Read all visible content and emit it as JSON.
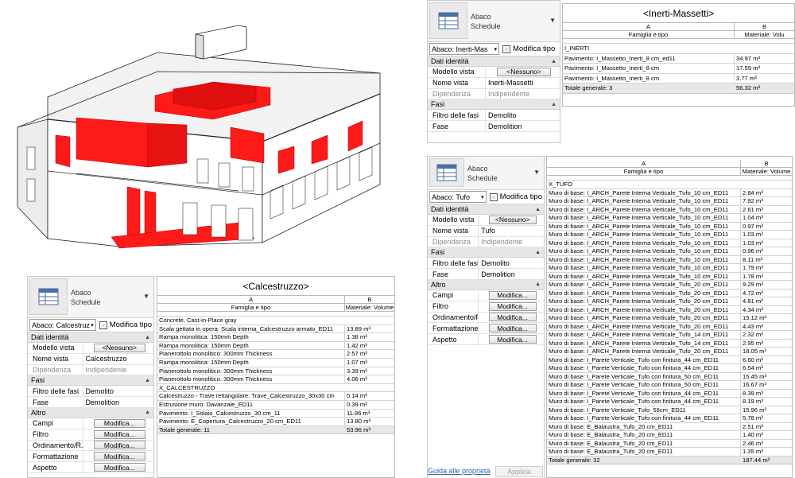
{
  "colors": {
    "highlight": "#ff1a1a",
    "link": "#2a62b8"
  },
  "model_view": {
    "icon": "building-3d-model"
  },
  "panels": {
    "calcestruzzo": {
      "type_line1": "Abaco",
      "type_line2": "Schedule",
      "selector": "Abaco: Calcestruz",
      "edit_type": "Modifica tipo",
      "sections": [
        {
          "title": "Dati identità",
          "rows": [
            {
              "k": "Modello vista",
              "v": "<Nessuno>",
              "btn": true
            },
            {
              "k": "Nome vista",
              "v": "Calcestruzzo"
            },
            {
              "k": "Dipendenza",
              "v": "Indipendente",
              "dim": true
            }
          ]
        },
        {
          "title": "Fasi",
          "rows": [
            {
              "k": "Filtro delle fasi",
              "v": "Demolito"
            },
            {
              "k": "Fase",
              "v": "Demolition"
            }
          ]
        },
        {
          "title": "Altro",
          "rows": [
            {
              "k": "Campi",
              "v": "Modifica...",
              "btn": true
            },
            {
              "k": "Filtro",
              "v": "Modifica...",
              "btn": true
            },
            {
              "k": "Ordinamento/R...",
              "v": "Modifica...",
              "btn": true
            },
            {
              "k": "Formattazione",
              "v": "Modifica...",
              "btn": true
            },
            {
              "k": "Aspetto",
              "v": "Modifica...",
              "btn": true
            }
          ]
        }
      ]
    },
    "massetti": {
      "type_line1": "Abaco",
      "type_line2": "Schedule",
      "selector": "Abaco: Inerti-Mas",
      "edit_type": "Modifica tipo",
      "sections": [
        {
          "title": "Dati identità",
          "rows": [
            {
              "k": "Modello vista",
              "v": "<Nessuno>",
              "btn": true
            },
            {
              "k": "Nome vista",
              "v": "Inerti-Massetti"
            },
            {
              "k": "Dipendenza",
              "v": "Indipendente",
              "dim": true
            }
          ]
        },
        {
          "title": "Fasi",
          "rows": [
            {
              "k": "Filtro delle fasi",
              "v": "Demolito"
            },
            {
              "k": "Fase",
              "v": "Demolition"
            }
          ]
        }
      ]
    },
    "tufo": {
      "type_line1": "Abaco",
      "type_line2": "Schedule",
      "selector": "Abaco: Tufo",
      "edit_type": "Modifica tipo",
      "sections": [
        {
          "title": "Dati identità",
          "rows": [
            {
              "k": "Modello vista",
              "v": "<Nessuno>",
              "btn": true
            },
            {
              "k": "Nome vista",
              "v": "Tufo"
            },
            {
              "k": "Dipendenza",
              "v": "Indipendente",
              "dim": true
            }
          ]
        },
        {
          "title": "Fasi",
          "rows": [
            {
              "k": "Filtro delle fasi",
              "v": "Demolito"
            },
            {
              "k": "Fase",
              "v": "Demolition"
            }
          ]
        },
        {
          "title": "Altro",
          "rows": [
            {
              "k": "Campi",
              "v": "Modifica...",
              "btn": true
            },
            {
              "k": "Filtro",
              "v": "Modifica...",
              "btn": true
            },
            {
              "k": "Ordinamento/R...",
              "v": "Modifica...",
              "btn": true
            },
            {
              "k": "Formattazione",
              "v": "Modifica...",
              "btn": true
            },
            {
              "k": "Aspetto",
              "v": "Modifica...",
              "btn": true
            }
          ]
        }
      ],
      "help_link": "Guida alle proprietà",
      "apply": "Applica"
    }
  },
  "schedules": {
    "calcestruzzo": {
      "title": "<Calcestruzzo>",
      "col_a": "A",
      "col_b": "B",
      "head_a": "Famiglia e tipo",
      "head_b": "Materiale: Volume",
      "groups": [
        {
          "name": "Concrete, Cast-in-Place gray",
          "rows": [
            [
              "Scala gettata in opera: Scala interna_Calcestruzzo armato_ED11",
              "13.89 m³"
            ],
            [
              "Rampa monolitica: 150mm Depth",
              "1.38 m³"
            ],
            [
              "Rampa monolitica: 150mm Depth",
              "1.42 m³"
            ],
            [
              "Pianerottolo monolitico: 300mm Thickness",
              "2.57 m³"
            ],
            [
              "Rampa monolitica: 150mm Depth",
              "1.07 m³"
            ],
            [
              "Pianerottolo monolitico: 300mm Thickness",
              "3.39 m³"
            ],
            [
              "Pianerottolo monolitico: 300mm Thickness",
              "4.06 m³"
            ]
          ]
        },
        {
          "name": "X_CALCESTRUZZO",
          "rows": [
            [
              "Calcestruzzo - Trave rettangolare: Trave_Calcestruzzo_30x30 cm",
              "0.14 m³"
            ],
            [
              "Estrusione muro: Davanzale_ED11",
              "0.39 m³"
            ],
            [
              "Pavimento: I_Solaio_Calcestruzzo_30 cm_11",
              "11.86 m³"
            ],
            [
              "Pavimento: E_Copertura_Calcestruzzo_20 cm_ED11",
              "13.80 m³"
            ]
          ]
        }
      ],
      "total_label": "Totale generale: 11",
      "total_value": "53.96 m³"
    },
    "massetti": {
      "title": "<Inerti-Massetti>",
      "col_a": "A",
      "col_b": "B",
      "head_a": "Famiglia e tipo",
      "head_b": "Materiale: Volu",
      "groups": [
        {
          "name": "I_INERTI",
          "rows": [
            [
              "Pavimento: I_Massetto_Inerti_8 cm_ed11",
              "34.97 m³"
            ],
            [
              "Pavimento: I_Massetto_Inerti_8 cm",
              "17.59 m³"
            ],
            [
              "Pavimento: I_Massetto_Inerti_8 cm",
              "3.77 m³"
            ]
          ]
        }
      ],
      "total_label": "Totale generale: 3",
      "total_value": "56.32 m³"
    },
    "tufo": {
      "title": "",
      "col_a": "A",
      "col_b": "B",
      "head_a": "Famiglia e tipo",
      "head_b": "Materiale: Volume",
      "groups": [
        {
          "name": "X_TUFO",
          "rows": [
            [
              "Muro di base: I_ARCH_Parete Interna Verticale_Tufo_10 cm_ED11",
              "2.84 m³"
            ],
            [
              "Muro di base: I_ARCH_Parete Interna Verticale_Tufo_10 cm_ED11",
              "7.92 m³"
            ],
            [
              "Muro di base: I_ARCH_Parete Interna Verticale_Tufo_10 cm_ED11",
              "2.61 m³"
            ],
            [
              "Muro di base: I_ARCH_Parete Interna Verticale_Tufo_10 cm_ED11",
              "1.04 m³"
            ],
            [
              "Muro di base: I_ARCH_Parete Interna Verticale_Tufo_10 cm_ED11",
              "0.97 m³"
            ],
            [
              "Muro di base: I_ARCH_Parete Interna Verticale_Tufo_10 cm_ED11",
              "1.03 m³"
            ],
            [
              "Muro di base: I_ARCH_Parete Interna Verticale_Tufo_10 cm_ED11",
              "1.03 m³"
            ],
            [
              "Muro di base: I_ARCH_Parete Interna Verticale_Tufo_10 cm_ED11",
              "0.96 m³"
            ],
            [
              "Muro di base: I_ARCH_Parete Interna Verticale_Tufo_10 cm_ED11",
              "8.11 m³"
            ],
            [
              "Muro di base: I_ARCH_Parete Interna Verticale_Tufo_10 cm_ED11",
              "1.79 m³"
            ],
            [
              "Muro di base: I_ARCH_Parete Interna Verticale_Tufo_10 cm_ED11",
              "1.78 m³"
            ],
            [
              "Muro di base: I_ARCH_Parete Interna Verticale_Tufo_20 cm_ED11",
              "9.29 m³"
            ],
            [
              "Muro di base: I_ARCH_Parete Interna Verticale_Tufo_20 cm_ED11",
              "4.72 m³"
            ],
            [
              "Muro di base: I_ARCH_Parete Interna Verticale_Tufo_20 cm_ED11",
              "4.81 m³"
            ],
            [
              "Muro di base: I_ARCH_Parete Interna Verticale_Tufo_20 cm_ED11",
              "4.34 m³"
            ],
            [
              "Muro di base: I_ARCH_Parete Interna Verticale_Tufo_20 cm_ED11",
              "15.12 m³"
            ],
            [
              "Muro di base: I_ARCH_Parete Interna Verticale_Tufo_20 cm_ED11",
              "4.43 m³"
            ],
            [
              "Muro di base: I_ARCH_Parete Interna Verticale_Tufo_14 cm_ED11",
              "2.32 m³"
            ],
            [
              "Muro di base: I_ARCH_Parete Interna Verticale_Tufo_14 cm_ED11",
              "2.95 m³"
            ],
            [
              "Muro di base: I_ARCH_Parete Interna Verticale_Tufo_20 cm_ED11",
              "18.05 m³"
            ],
            [
              "Muro di base: I_Parete Verticale_Tufo con finitura_44 cm_ED11",
              "6.60 m³"
            ],
            [
              "Muro di base: I_Parete Verticale_Tufo con finitura_44 cm_ED11",
              "6.54 m³"
            ],
            [
              "Muro di base: I_Parete Verticale_Tufo con finitura_50 cm_ED11",
              "15.45 m³"
            ],
            [
              "Muro di base: I_Parete Verticale_Tufo con finitura_50 cm_ED11",
              "16.67 m³"
            ],
            [
              "Muro di base: I_Parete Verticale_Tufo con finitura_44 cm_ED11",
              "8.39 m³"
            ],
            [
              "Muro di base: I_Parete Verticale_Tufo con finitura_44 cm_ED11",
              "8.19 m³"
            ],
            [
              "Muro di base: I_Parete Verticale_Tufo_56cm_ED11",
              "15.96 m³"
            ],
            [
              "Muro di base: I_Parete Verticale_Tufo con finitura_44 cm_ED11",
              "5.78 m³"
            ],
            [
              "Muro di base: E_Balaustra_Tufo_20 cm_ED11",
              "2.51 m³"
            ],
            [
              "Muro di base: E_Balaustra_Tufo_20 cm_ED11",
              "1.40 m³"
            ],
            [
              "Muro di base: E_Balaustra_Tufo_20 cm_ED11",
              "2.46 m³"
            ],
            [
              "Muro di base: E_Balaustra_Tufo_20 cm_ED11",
              "1.35 m³"
            ]
          ]
        }
      ],
      "total_label": "Totale generale: 32",
      "total_value": "187.44 m³"
    }
  }
}
